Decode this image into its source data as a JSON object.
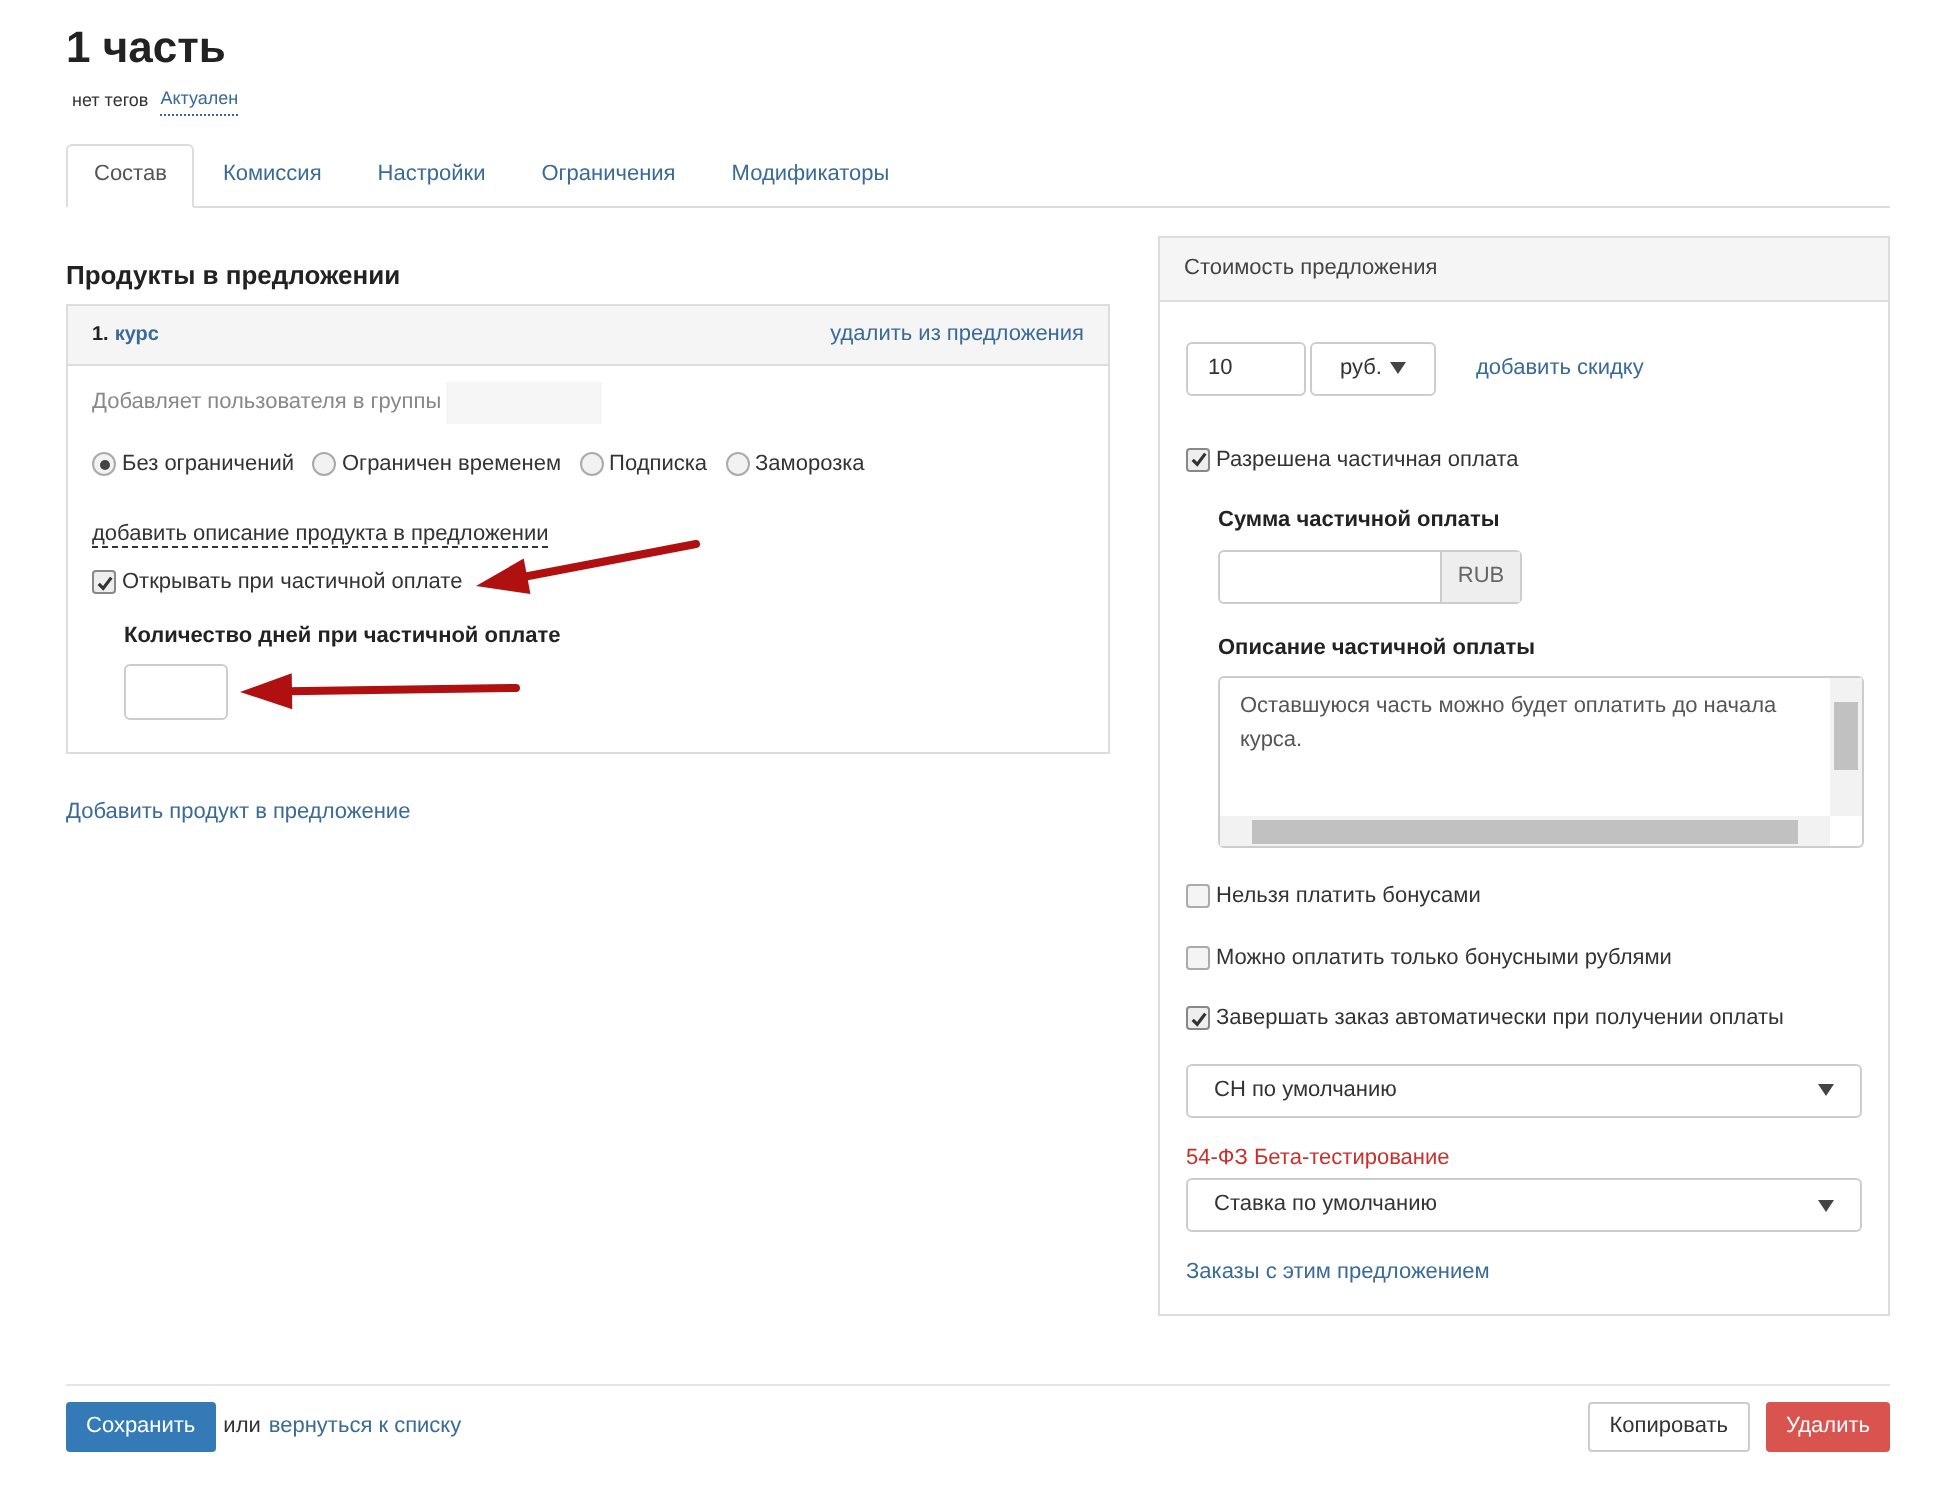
{
  "page": {
    "title": "1 часть",
    "tags": "нет тегов",
    "status": "Актуален"
  },
  "tabs": [
    {
      "label": "Состав",
      "selected": true
    },
    {
      "label": "Комиссия",
      "selected": false
    },
    {
      "label": "Настройки",
      "selected": false
    },
    {
      "label": "Ограничения",
      "selected": false
    },
    {
      "label": "Модификаторы",
      "selected": false
    }
  ],
  "products": {
    "heading": "Продукты в предложении",
    "items": [
      {
        "number": "1.",
        "name": "курс",
        "remove_link": "удалить из предложения",
        "groups_label": "Добавляет пользователя в группы",
        "access_options": [
          {
            "label": "Без ограничений",
            "selected": true
          },
          {
            "label": "Ограничен временем",
            "selected": false
          },
          {
            "label": "Подписка",
            "selected": false
          },
          {
            "label": "Заморозка",
            "selected": false
          }
        ],
        "description_link": "добавить описание продукта в предложении",
        "open_on_partial": {
          "label": "Открывать при частичной оплате",
          "checked": true
        },
        "days_label": "Количество дней при частичной оплате"
      }
    ],
    "add_link": "Добавить продукт в предложение"
  },
  "price": {
    "heading": "Стоимость предложения",
    "amount": "10",
    "currency": "руб.",
    "discount_link": "добавить скидку",
    "partial_allowed": {
      "label": "Разрешена частичная оплата",
      "checked": true
    },
    "partial_sum_label": "Сумма частичной оплаты",
    "partial_sum_unit": "RUB",
    "partial_description_label": "Описание частичной оплаты",
    "partial_description": "Оставшуюся часть можно будет оплатить до начала курса.",
    "options": [
      {
        "label": "Нельзя платить бонусами",
        "checked": false
      },
      {
        "label": "Можно оплатить только бонусными рублями",
        "checked": false
      },
      {
        "label": "Завершать заказ автоматически при получении оплаты",
        "checked": true
      }
    ],
    "tax_system": "СН по умолчанию",
    "beta_label": "54-ФЗ Бета-тестирование",
    "tax_rate": "Ставка по умолчанию",
    "orders_link": "Заказы с этим предложением"
  },
  "footer": {
    "save": "Сохранить",
    "or": "или",
    "back_link": "вернуться к списку",
    "copy": "Копировать",
    "delete": "Удалить"
  }
}
